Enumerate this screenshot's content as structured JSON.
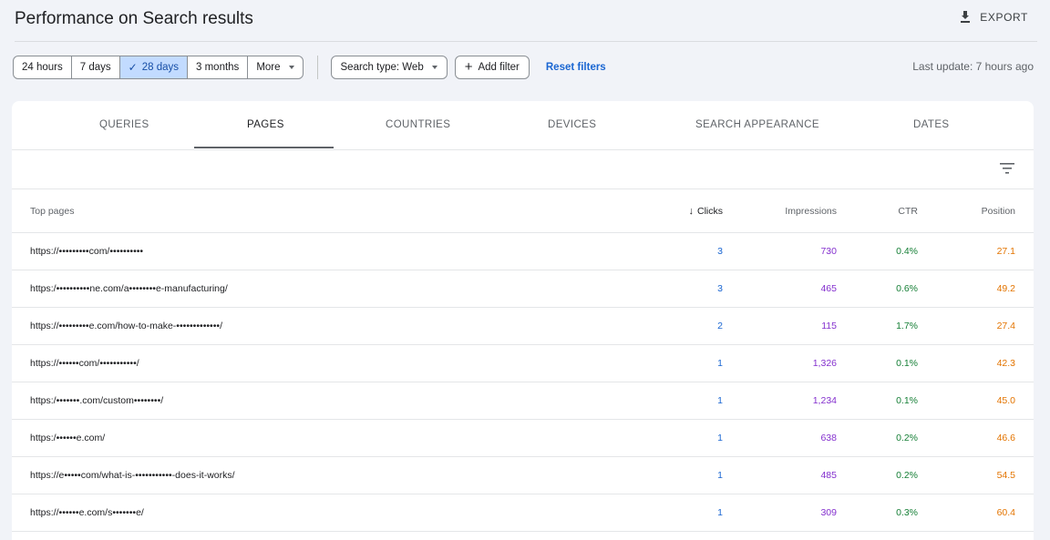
{
  "header": {
    "title": "Performance on Search results",
    "export_label": "EXPORT",
    "export_icon": "download-icon"
  },
  "filters": {
    "date_ranges": [
      "24 hours",
      "7 days",
      "28 days",
      "3 months",
      "More"
    ],
    "selected": "28 days",
    "search_type": "Search type: Web",
    "add_filter": "Add filter",
    "reset": "Reset filters",
    "last_update": "Last update: 7 hours ago"
  },
  "tabs": [
    "QUERIES",
    "PAGES",
    "COUNTRIES",
    "DEVICES",
    "SEARCH APPEARANCE",
    "DATES"
  ],
  "active_tab": "PAGES",
  "table": {
    "headers": {
      "page": "Top pages",
      "clicks": "Clicks",
      "impressions": "Impressions",
      "ctr": "CTR",
      "position": "Position"
    },
    "rows": [
      {
        "url": "https://•••••••••com/••••••••••",
        "clicks": "3",
        "impressions": "730",
        "ctr": "0.4%",
        "position": "27.1"
      },
      {
        "url": "https:/••••••••••ne.com/a••••••••e-manufacturing/",
        "clicks": "3",
        "impressions": "465",
        "ctr": "0.6%",
        "position": "49.2"
      },
      {
        "url": "https://•••••••••e.com/how-to-make-•••••••••••••/",
        "clicks": "2",
        "impressions": "115",
        "ctr": "1.7%",
        "position": "27.4"
      },
      {
        "url": "https://••••••com/•••••••••••/",
        "clicks": "1",
        "impressions": "1,326",
        "ctr": "0.1%",
        "position": "42.3"
      },
      {
        "url": "https:/•••••••.com/custom••••••••/",
        "clicks": "1",
        "impressions": "1,234",
        "ctr": "0.1%",
        "position": "45.0"
      },
      {
        "url": "https:/••••••e.com/",
        "clicks": "1",
        "impressions": "638",
        "ctr": "0.2%",
        "position": "46.6"
      },
      {
        "url": "https://e•••••com/what-is-•••••••••••-does-it-works/",
        "clicks": "1",
        "impressions": "485",
        "ctr": "0.2%",
        "position": "54.5"
      },
      {
        "url": "https://••••••e.com/s•••••••e/",
        "clicks": "1",
        "impressions": "309",
        "ctr": "0.3%",
        "position": "60.4"
      }
    ]
  }
}
